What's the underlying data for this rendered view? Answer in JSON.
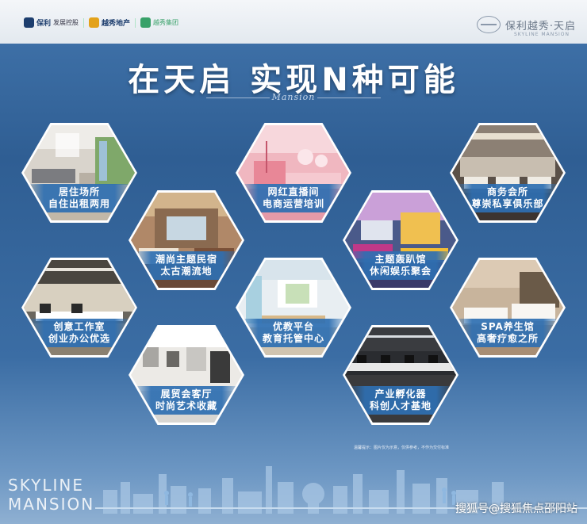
{
  "header": {
    "brands": [
      {
        "icon": "poly-developments-logo",
        "name": "保利",
        "sub": "发展控股",
        "color": "#1d3e6e"
      },
      {
        "icon": "yuexiu-property-logo",
        "name": "越秀地产",
        "sub": "",
        "color": "#e3a21a"
      },
      {
        "icon": "partner-logo",
        "name": "",
        "sub": "越秀集团",
        "color": "#38a169"
      }
    ],
    "project_logo": "保利越秀·天启",
    "project_logo_sub": "SKYLINE MANSION"
  },
  "headline": "在天启  实现N种可能",
  "headline_script": "Mansion",
  "hexagons": [
    {
      "line1": "居住场所",
      "line2": "自住出租两用"
    },
    {
      "line1": "网红直播间",
      "line2": "电商运营培训"
    },
    {
      "line1": "商务会所",
      "line2": "尊崇私享俱乐部"
    },
    {
      "line1": "潮尚主题民宿",
      "line2": "太古潮流地"
    },
    {
      "line1": "主题轰趴馆",
      "line2": "休闲娱乐聚会"
    },
    {
      "line1": "创意工作室",
      "line2": "创业办公优选"
    },
    {
      "line1": "优教平台",
      "line2": "教育托管中心"
    },
    {
      "line1": "SPA养生馆",
      "line2": "高奢疗愈之所"
    },
    {
      "line1": "展贸会客厅",
      "line2": "时尚艺术收藏"
    },
    {
      "line1": "产业孵化器",
      "line2": "科创人才基地"
    }
  ],
  "note": "温馨提示：图片仅为示意，仅供参考，不作为交付标准",
  "footer": {
    "skyline_line1": "SKYLINE",
    "skyline_line2": "MANSION",
    "watermark": "搜狐号@搜狐焦点邵阳站"
  },
  "colors": {
    "background_top": "#2f5e93",
    "caption_band": "#2e6fb2",
    "headline": "#ffffff"
  }
}
